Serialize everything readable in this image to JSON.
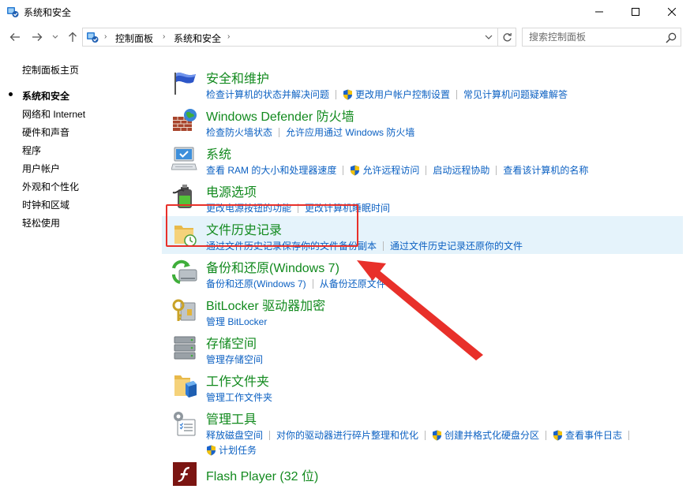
{
  "window": {
    "title": "系统和安全",
    "icon": "control-panel-icon"
  },
  "address": {
    "breadcrumbs": [
      "控制面板",
      "系统和安全"
    ],
    "search_placeholder": "搜索控制面板"
  },
  "sidebar": {
    "home": "控制面板主页",
    "items": [
      {
        "label": "系统和安全",
        "current": true
      },
      {
        "label": "网络和 Internet"
      },
      {
        "label": "硬件和声音"
      },
      {
        "label": "程序"
      },
      {
        "label": "用户帐户"
      },
      {
        "label": "外观和个性化"
      },
      {
        "label": "时钟和区域"
      },
      {
        "label": "轻松使用"
      }
    ]
  },
  "categories": [
    {
      "title": "安全和维护",
      "icon": "flag-icon",
      "links": [
        "检查计算机的状态并解决问题",
        "更改用户帐户控制设置",
        "常见计算机问题疑难解答"
      ]
    },
    {
      "title": "Windows Defender 防火墙",
      "icon": "firewall-icon",
      "links": [
        "检查防火墙状态",
        "允许应用通过 Windows 防火墙"
      ]
    },
    {
      "title": "系统",
      "icon": "computer-icon",
      "links": [
        "查看 RAM 的大小和处理器速度",
        "允许远程访问",
        "启动远程协助",
        "查看该计算机的名称"
      ]
    },
    {
      "title": "电源选项",
      "icon": "battery-icon",
      "links": [
        "更改电源按钮的功能",
        "更改计算机睡眠时间"
      ]
    },
    {
      "title": "文件历史记录",
      "icon": "file-history-icon",
      "links": [
        "通过文件历史记录保存你的文件备份副本",
        "通过文件历史记录还原你的文件"
      ]
    },
    {
      "title": "备份和还原(Windows 7)",
      "icon": "backup-icon",
      "links": [
        "备份和还原(Windows 7)",
        "从备份还原文件"
      ]
    },
    {
      "title": "BitLocker 驱动器加密",
      "icon": "bitlocker-icon",
      "links": [
        "管理 BitLocker"
      ]
    },
    {
      "title": "存储空间",
      "icon": "storage-icon",
      "links": [
        "管理存储空间"
      ]
    },
    {
      "title": "工作文件夹",
      "icon": "work-folders-icon",
      "links": [
        "管理工作文件夹"
      ]
    },
    {
      "title": "管理工具",
      "icon": "admin-tools-icon",
      "links": [
        "释放磁盘空间",
        "对你的驱动器进行碎片整理和优化",
        "创建并格式化硬盘分区",
        "查看事件日志",
        "计划任务"
      ]
    },
    {
      "title": "Flash Player (32 位)",
      "icon": "flash-player-icon",
      "links": []
    }
  ],
  "colors": {
    "category_title": "#128a1e",
    "link": "#0b60c2",
    "hover_row": "#e5f3fb",
    "annotation": "#e8302a"
  }
}
